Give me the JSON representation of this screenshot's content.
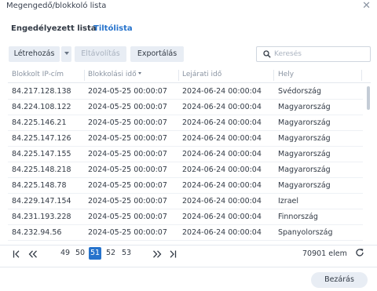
{
  "window": {
    "title": "Megengedő/blokkoló lista"
  },
  "tabs": [
    {
      "label": "Engedélyezett lista"
    },
    {
      "label": "Tiltólista"
    }
  ],
  "toolbar": {
    "create_label": "Létrehozás",
    "unblock_label": "Eltávolítás",
    "export_label": "Exportálás",
    "search_placeholder": "Keresés"
  },
  "table": {
    "headers": [
      "Blokkolt IP-cím",
      "Blokkolási idő",
      "Lejárati idő",
      "Hely"
    ],
    "sort_column": 1,
    "rows": [
      [
        "84.217.128.138",
        "2024-05-25 00:00:07",
        "2024-06-24 00:00:04",
        "Svédország"
      ],
      [
        "84.224.108.122",
        "2024-05-25 00:00:07",
        "2024-06-24 00:00:04",
        "Magyarország"
      ],
      [
        "84.225.146.21",
        "2024-05-25 00:00:07",
        "2024-06-24 00:00:04",
        "Magyarország"
      ],
      [
        "84.225.147.126",
        "2024-05-25 00:00:07",
        "2024-06-24 00:00:04",
        "Magyarország"
      ],
      [
        "84.225.147.155",
        "2024-05-25 00:00:07",
        "2024-06-24 00:00:04",
        "Magyarország"
      ],
      [
        "84.225.148.218",
        "2024-05-25 00:00:07",
        "2024-06-24 00:00:04",
        "Magyarország"
      ],
      [
        "84.225.148.78",
        "2024-05-25 00:00:07",
        "2024-06-24 00:00:04",
        "Magyarország"
      ],
      [
        "84.229.147.154",
        "2024-05-25 00:00:07",
        "2024-06-24 00:00:04",
        "Izrael"
      ],
      [
        "84.231.193.228",
        "2024-05-25 00:00:07",
        "2024-06-24 00:00:04",
        "Finnország"
      ],
      [
        "84.232.94.56",
        "2024-05-25 00:00:07",
        "2024-06-24 00:00:04",
        "Spanyolország"
      ]
    ]
  },
  "pagination": {
    "pages": [
      "49",
      "50",
      "51",
      "52",
      "53"
    ],
    "current": "51",
    "total_label": "70901 elem"
  },
  "footer": {
    "close_label": "Bezárás"
  },
  "colors": {
    "accent": "#2673cc",
    "button_bg": "#e8edf4",
    "text": "#323a45",
    "muted": "#8a94a2"
  },
  "icons": [
    "close-icon",
    "caret-down-icon",
    "search-icon",
    "sort-desc-icon",
    "first-page-icon",
    "prev-page-icon",
    "next-page-icon",
    "last-page-icon",
    "refresh-icon"
  ]
}
